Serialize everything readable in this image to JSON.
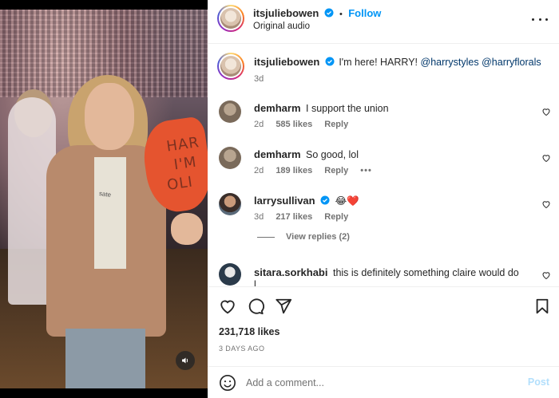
{
  "post": {
    "author": "itsjuliebowen",
    "follow_label": "Follow",
    "separator": "•",
    "audio": "Original audio",
    "more_icon": "more-horizontal-icon",
    "caption": {
      "author": "itsjuliebowen",
      "text": "I'm here! HARRY! ",
      "mention_1": "@harrystyles",
      "mention_2": "@harryflorals",
      "age": "3d"
    },
    "video": {
      "sign_text_1": "HAR",
      "sign_text_2": "I'M",
      "sign_text_3": "OLI",
      "shirt_text": "sate",
      "mute_icon": "volume-icon"
    }
  },
  "comments": [
    {
      "user": "demharm",
      "text": "I support the union",
      "age": "2d",
      "likes": "585 likes",
      "reply": "Reply"
    },
    {
      "user": "demharm",
      "text": "So good, lol",
      "age": "2d",
      "likes": "189 likes",
      "reply": "Reply",
      "more": "•••"
    },
    {
      "user": "larrysullivan",
      "text": "😂❤️",
      "age": "3d",
      "likes": "217 likes",
      "reply": "Reply",
      "view_replies": "View replies (2)"
    },
    {
      "user": "sitara.sorkhabi",
      "text": "this is definitely something claire would do",
      "overflow": "l..."
    }
  ],
  "actions": {
    "like_icon": "heart-icon",
    "comment_icon": "comment-icon",
    "share_icon": "send-icon",
    "save_icon": "bookmark-icon",
    "likes": "231,718 likes",
    "date": "3 DAYS AGO"
  },
  "add_comment": {
    "emoji_icon": "emoji-icon",
    "placeholder": "Add a comment...",
    "post_label": "Post"
  },
  "colors": {
    "accent": "#0095f6",
    "post_disabled": "#b2dffc",
    "secondary_text": "#737373",
    "heart_red": "#ed4956"
  }
}
